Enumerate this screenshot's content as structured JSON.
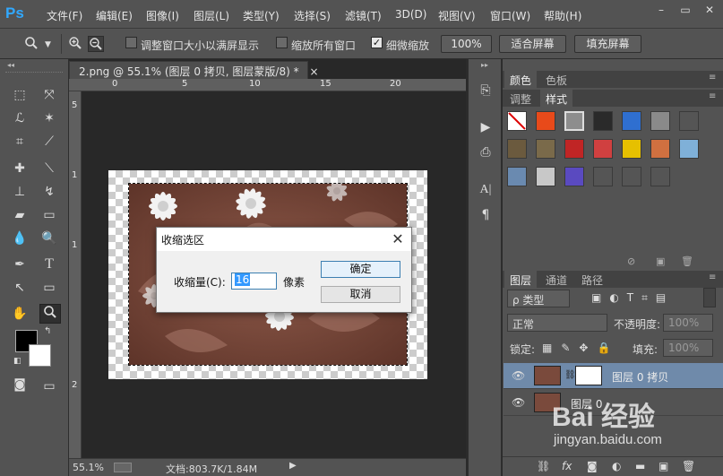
{
  "menubar": {
    "logo": "Ps",
    "items": [
      "文件(F)",
      "编辑(E)",
      "图像(I)",
      "图层(L)",
      "类型(Y)",
      "选择(S)",
      "滤镜(T)",
      "3D(D)",
      "视图(V)",
      "窗口(W)",
      "帮助(H)"
    ],
    "minimize": "–",
    "restore": "▭",
    "close": "✕"
  },
  "options": {
    "resize_windows": "调整窗口大小以满屏显示",
    "zoom_all": "缩放所有窗口",
    "scrubby_zoom": "细微缩放",
    "scrubby_checked": true,
    "zoom_100": "100%",
    "fit_screen": "适合屏幕",
    "fill_screen": "填充屏幕"
  },
  "document": {
    "tab_title": "2.png @ 55.1% (图层 0 拷贝, 图层蒙版/8) *",
    "tab_close": "×",
    "ruler_h": [
      "0",
      "5",
      "10",
      "15",
      "20"
    ],
    "ruler_v": [
      "5",
      "1",
      "1",
      "2"
    ]
  },
  "statusbar": {
    "zoom": "55.1%",
    "doc_info": "文档:803.7K/1.84M"
  },
  "dialog": {
    "title": "收缩选区",
    "label": "收缩量(C):",
    "value": "16",
    "unit": "像素",
    "ok": "确定",
    "cancel": "取消",
    "close": "✕"
  },
  "panels": {
    "color_tab": "颜色",
    "swatches_tab": "色板",
    "adjust_tab": "调整",
    "styles_tab": "样式",
    "layers_tab": "图层",
    "channels_tab": "通道",
    "paths_tab": "路径",
    "kind_filter": "ρ 类型",
    "blend_mode": "正常",
    "opacity_label": "不透明度:",
    "opacity_value": "100%",
    "lock_label": "锁定:",
    "fill_label": "填充:",
    "fill_value": "100%"
  },
  "layers": [
    {
      "name": "图层 0 拷贝",
      "selected": true,
      "has_mask": true
    },
    {
      "name": "图层 0",
      "selected": false,
      "has_mask": false
    }
  ],
  "style_colors": [
    "#ffffff",
    "#e84a1a",
    "#8d8d8d",
    "#2a2a2a",
    "#2f6fd0",
    "#8a8a8a",
    "#555555",
    "#6b5a3e",
    "#7a6a4a",
    "#c02525",
    "#d04040",
    "#e6c000",
    "#d07040",
    "#7fb0d8",
    "#6a8ab0",
    "#c8c8c8",
    "#5a4ac0",
    "#555555",
    "#555555",
    "#555555"
  ],
  "watermark": {
    "brand": "Bai 经验",
    "url": "jingyan.baidu.com"
  }
}
